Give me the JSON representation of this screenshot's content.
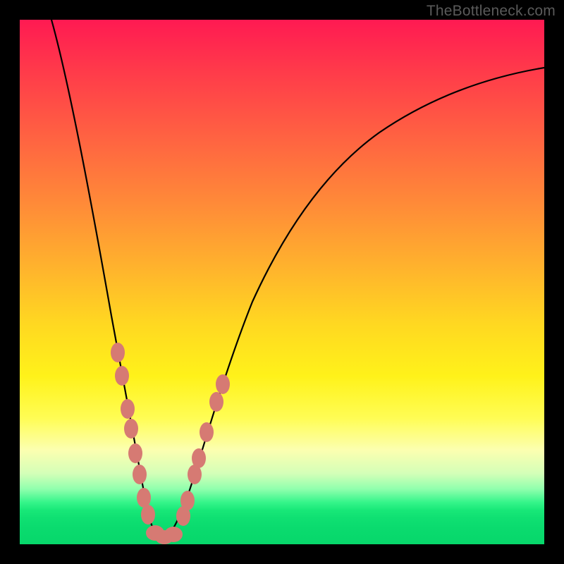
{
  "watermark": "TheBottleneck.com",
  "colors": {
    "background_frame": "#000000",
    "marker": "#d67a73",
    "curve": "#000000",
    "gradient_top": "#ff1a52",
    "gradient_mid": "#fff21a",
    "gradient_bottom": "#07d76b"
  },
  "chart_data": {
    "type": "line",
    "title": "",
    "xlabel": "",
    "ylabel": "",
    "xlim": [
      0,
      100
    ],
    "ylim": [
      0,
      100
    ],
    "grid": false,
    "legend": false,
    "annotations": [
      "TheBottleneck.com"
    ],
    "series": [
      {
        "name": "bottleneck-curve",
        "x": [
          2,
          5,
          8,
          11,
          14,
          17,
          19,
          21,
          23,
          25,
          26,
          27,
          29,
          32,
          36,
          42,
          50,
          60,
          72,
          86,
          100
        ],
        "y": [
          100,
          87,
          74,
          61,
          48,
          35,
          24,
          15,
          8,
          3,
          1,
          1,
          3,
          10,
          22,
          38,
          54,
          67,
          77,
          84,
          88
        ]
      }
    ],
    "markers": [
      {
        "x": 17.5,
        "y": 36
      },
      {
        "x": 18.2,
        "y": 32
      },
      {
        "x": 19.5,
        "y": 25
      },
      {
        "x": 20.2,
        "y": 22
      },
      {
        "x": 21.0,
        "y": 17
      },
      {
        "x": 21.8,
        "y": 13
      },
      {
        "x": 22.8,
        "y": 8
      },
      {
        "x": 23.7,
        "y": 5
      },
      {
        "x": 25.0,
        "y": 1.5
      },
      {
        "x": 26.0,
        "y": 0.8
      },
      {
        "x": 27.0,
        "y": 0.8
      },
      {
        "x": 28.0,
        "y": 1.5
      },
      {
        "x": 30.0,
        "y": 5
      },
      {
        "x": 30.8,
        "y": 8
      },
      {
        "x": 32.2,
        "y": 13
      },
      {
        "x": 33.0,
        "y": 16
      },
      {
        "x": 34.5,
        "y": 21
      },
      {
        "x": 36.5,
        "y": 27
      },
      {
        "x": 37.5,
        "y": 30
      }
    ],
    "note": "Values estimated from pixel positions; x ~ component ratio axis (0-100), y ~ bottleneck percentage (0-100). Curve minimum near x≈26, y≈0."
  }
}
